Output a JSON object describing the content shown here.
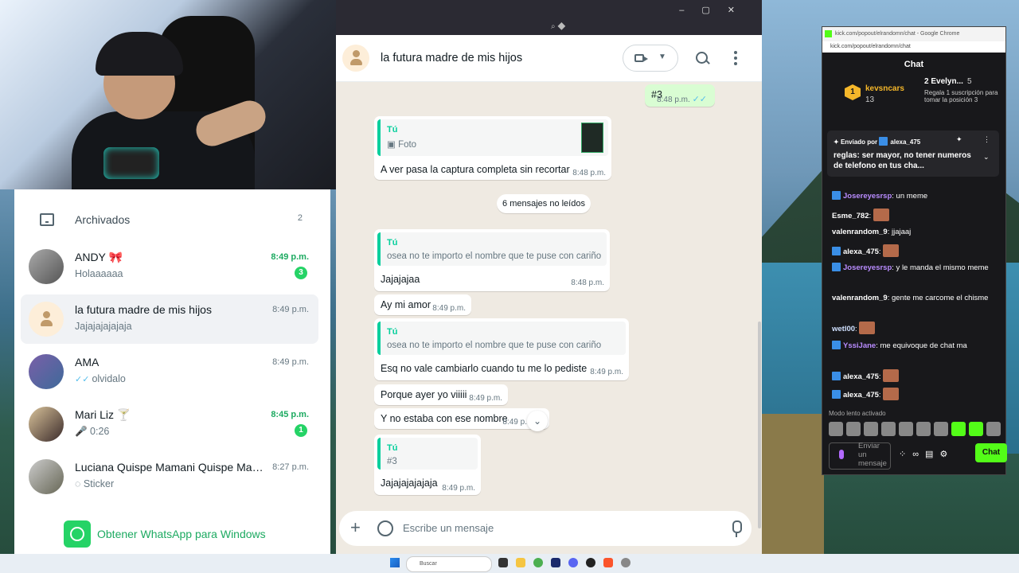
{
  "conversation": {
    "title": "la futura madre de mis hijos",
    "unread_label": "6 mensajes no leídos",
    "composer_placeholder": "Escribe un mensaje",
    "messages": [
      {
        "text": "#3",
        "time": "8:48 p.m.",
        "ticks": "✓✓"
      },
      {
        "quote_author": "Tú",
        "quote_text": "Foto",
        "text": "A ver pasa la captura completa sin recortar",
        "time": "8:48 p.m."
      },
      {
        "quote_author": "Tú",
        "quote_text": "osea no te importo el nombre que te puse con cariño",
        "text": "Jajajajaa",
        "time": "8:48 p.m."
      },
      {
        "text": "Ay mi amor",
        "time": "8:49 p.m."
      },
      {
        "quote_author": "Tú",
        "quote_text": "osea no te importo el nombre que te puse con cariño",
        "text": "Esq no vale cambiarlo cuando tu me lo pediste",
        "time": "8:49 p.m."
      },
      {
        "text": "Porque ayer yo viiiii",
        "time": "8:49 p.m."
      },
      {
        "text": "Y no estaba con ese nombre",
        "time": "8:49 p."
      },
      {
        "quote_author": "Tú",
        "quote_text": "#3",
        "text": "Jajajajajajaja",
        "time": "8:49 p.m."
      }
    ]
  },
  "chat_list": {
    "archived_label": "Archivados",
    "archived_count": "2",
    "items": [
      {
        "name": "ANDY 🎀",
        "time": "8:49 p.m.",
        "preview": "Holaaaaaa",
        "badge": "3"
      },
      {
        "name": "la futura madre de mis hijos",
        "time": "8:49 p.m.",
        "preview": "Jajajajajajaja"
      },
      {
        "name": "AMA",
        "time": "8:49 p.m.",
        "preview": "olvidalo",
        "ticks": "✓✓"
      },
      {
        "name": "Mari Liz 🍸",
        "time": "8:45 p.m.",
        "preview": "🎤 0:26",
        "badge": "1"
      },
      {
        "name": "Luciana Quispe Mamani Quispe Mam...",
        "time": "8:27 p.m.",
        "preview": "Sticker"
      }
    ],
    "get_app_label": "Obtener WhatsApp para Windows"
  },
  "kick": {
    "window_title": "kick.com/popout/elrandomn/chat - Google Chrome",
    "url": "kick.com/popout/elrandomn/chat",
    "header": "Chat",
    "leader1_rank": "1",
    "leader1_name": "kevsncars",
    "leader1_count": "13",
    "leader2_rank": "2",
    "leader2_name": "Evelyn...",
    "leader2_count": "5",
    "leader3_text": "Regala 1 suscripción para tomar la posición 3",
    "pinned_by": "Enviado por",
    "pinned_user": "alexa_475",
    "pinned_text": "reglas: ser mayor, no tener numeros de telefono en tus cha...",
    "messages": [
      {
        "user": "Josereyesrsp",
        "text": ": un meme",
        "color": "#b98cff",
        "badge": true
      },
      {
        "user": "Esme_782",
        "text": ":",
        "color": "#ffffff",
        "emote": true
      },
      {
        "user": "valenrandom_9",
        "text": ": jjajaaj",
        "color": "#ffffff"
      },
      {
        "user": "alexa_475",
        "text": ":",
        "color": "#ffffff",
        "badge": true,
        "emote": true
      },
      {
        "user": "Josereyesrsp",
        "text": ": y le manda el mismo meme",
        "color": "#b98cff",
        "badge": true
      },
      {
        "user": "valenrandom_9",
        "text": ": gente me carcome el chisme",
        "color": "#ffffff"
      },
      {
        "user": "wetl00",
        "text": ":",
        "color": "#cfe0ff",
        "emote": true
      },
      {
        "user": "YssiJane",
        "text": ": me equivoque de chat ma",
        "color": "#b98cff",
        "badge": true
      },
      {
        "user": "alexa_475",
        "text": ":",
        "color": "#ffffff",
        "badge": true,
        "emote": true
      },
      {
        "user": "alexa_475",
        "text": ":",
        "color": "#ffffff",
        "badge": true,
        "emote": true
      }
    ],
    "slow_mode": "Modo lento activado",
    "input_placeholder": "Enviar un mensaje",
    "send_label": "Chat"
  },
  "taskbar": {
    "search_label": "Buscar"
  },
  "colors": {
    "wa_green": "#25d366",
    "kick_green": "#53fc18"
  }
}
